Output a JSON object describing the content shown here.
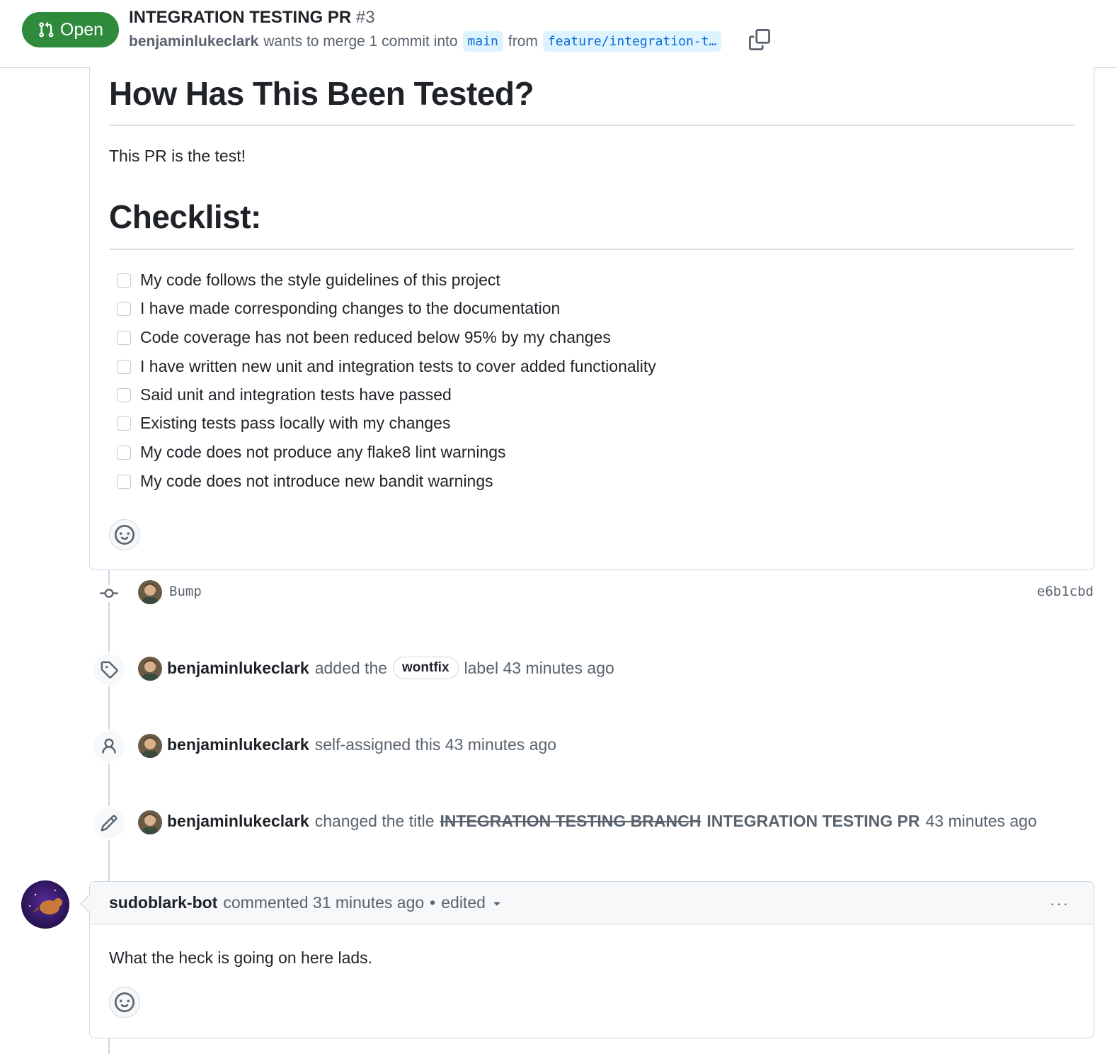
{
  "header": {
    "state": "Open",
    "title": "INTEGRATION TESTING PR",
    "number": "#3",
    "author": "benjaminlukeclark",
    "merge_text": "wants to merge 1 commit into",
    "base_branch": "main",
    "from_text": "from",
    "head_branch": "feature/integration-t…"
  },
  "description": {
    "heading_tested": "How Has This Been Tested?",
    "tested_text": "This PR is the test!",
    "heading_checklist": "Checklist:",
    "checklist": [
      {
        "label": "My code follows the style guidelines of this project",
        "checked": false
      },
      {
        "label": "I have made corresponding changes to the documentation",
        "checked": false
      },
      {
        "label": "Code coverage has not been reduced below 95% by my changes",
        "checked": false
      },
      {
        "label": "I have written new unit and integration tests to cover added functionality",
        "checked": false
      },
      {
        "label": "Said unit and integration tests have passed",
        "checked": false
      },
      {
        "label": "Existing tests pass locally with my changes",
        "checked": false
      },
      {
        "label": "My code does not produce any flake8 lint warnings",
        "checked": false
      },
      {
        "label": "My code does not introduce new bandit warnings",
        "checked": false
      }
    ]
  },
  "timeline": {
    "commit": {
      "message": "Bump",
      "sha": "e6b1cbd"
    },
    "label_event": {
      "actor": "benjaminlukeclark",
      "pre": "added the",
      "label": "wontfix",
      "post": "label 43 minutes ago"
    },
    "assign_event": {
      "actor": "benjaminlukeclark",
      "text": "self-assigned this 43 minutes ago"
    },
    "rename_event": {
      "actor": "benjaminlukeclark",
      "pre": "changed the title",
      "old_title": "INTEGRATION TESTING BRANCH",
      "new_title": "INTEGRATION TESTING PR",
      "time": "43 minutes ago"
    }
  },
  "comment": {
    "author": "sudoblark-bot",
    "meta": "commented 31 minutes ago",
    "separator": "•",
    "edited": "edited",
    "more": "···",
    "body": "What the heck is going on here lads."
  },
  "colors": {
    "open_green": "#2f8a3c",
    "link_blue": "#0969da",
    "branch_bg": "#ddf4ff",
    "muted_text": "#59636e"
  }
}
